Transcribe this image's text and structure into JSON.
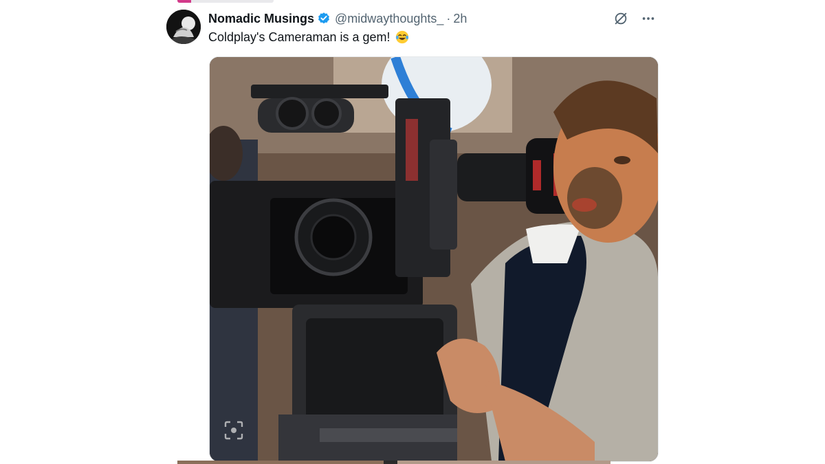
{
  "tweet": {
    "display_name": "Nomadic Musings",
    "handle": "@midwaythoughts_",
    "separator": "·",
    "timestamp": "2h",
    "text": "Coldplay's Cameraman is a gem!",
    "emoji": "face-with-tears-of-joy",
    "verified": true
  },
  "colors": {
    "verified_blue": "#1d9bf0",
    "text_primary": "#0f1419",
    "text_secondary": "#536471"
  },
  "icons": {
    "grok": "grok-icon",
    "more": "more-icon",
    "alt": "image-view-icon"
  }
}
